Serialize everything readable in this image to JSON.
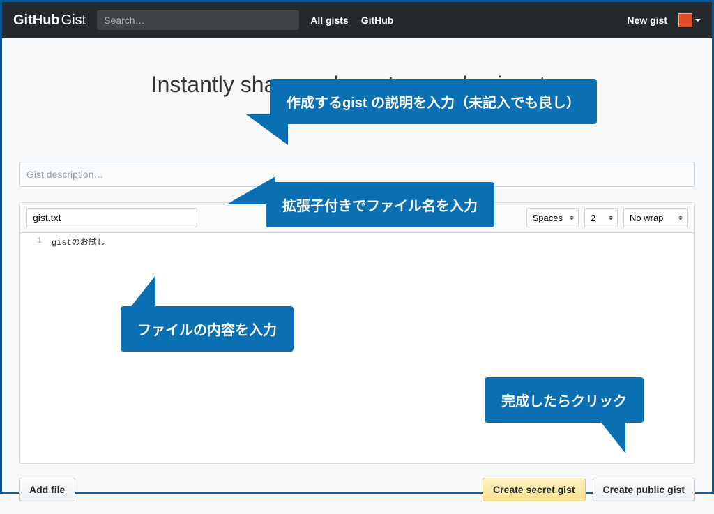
{
  "header": {
    "logo_bold": "GitHub",
    "logo_thin": "Gist",
    "search_placeholder": "Search…",
    "link_all_gists": "All gists",
    "link_github": "GitHub",
    "new_gist": "New gist"
  },
  "hero": "Instantly share code, notes, and snippets.",
  "form": {
    "description_placeholder": "Gist description…",
    "filename_value": "gist.txt",
    "indent_mode_label": "Spaces",
    "indent_size_label": "2",
    "wrap_label": "No wrap",
    "line_number": "1",
    "code_content": "gistのお試し"
  },
  "actions": {
    "add_file": "Add file",
    "create_secret": "Create secret gist",
    "create_public": "Create public gist"
  },
  "callouts": {
    "c1": "作成するgist の説明を入力（未記入でも良し）",
    "c2": "拡張子付きでファイル名を入力",
    "c3": "ファイルの内容を入力",
    "c4": "完成したらクリック"
  }
}
